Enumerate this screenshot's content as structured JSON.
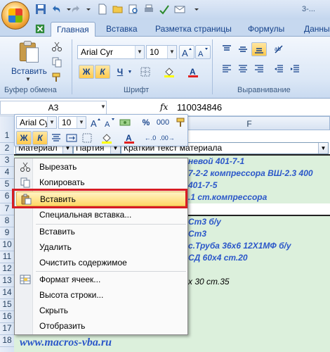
{
  "title_bar": {
    "doc_title": "3-..."
  },
  "tabs": [
    "Главная",
    "Вставка",
    "Разметка страницы",
    "Формулы",
    "Данны"
  ],
  "ribbon": {
    "clipboard": {
      "paste_label": "Вставить",
      "group_label": "Буфер обмена"
    },
    "font": {
      "font_name": "Arial Cyr",
      "font_size": "10",
      "bold": "Ж",
      "italic": "К",
      "underline": "Ч",
      "group_label": "Шрифт"
    },
    "alignment": {
      "group_label": "Выравнивание"
    }
  },
  "formula_bar": {
    "name_box": "A3",
    "fx": "fx",
    "formula": "110034846"
  },
  "sheet": {
    "column_f": "F",
    "rows": [
      "1",
      "2",
      "3",
      "4",
      "5",
      "6",
      "7",
      "8",
      "9",
      "10",
      "11",
      "12",
      "13",
      "14",
      "15",
      "16",
      "17",
      "18"
    ],
    "headers": {
      "material": "Материал",
      "batch": "Партия",
      "short_text": "Краткий текст материала"
    },
    "cells": {
      "r3": "невой 401-7-1",
      "r4": "7-2-2 компрессора ВШ-2.3 400",
      "r5": "401-7-5",
      "r6": ".1 ст.компрессора",
      "r8": "Ст3 б/у",
      "r9": "Ст3",
      "r10": "с.Труба 36х6 12Х1МФ б/у",
      "r11": "СД 60х4 ст.20",
      "r13": "х 30 ст.35"
    }
  },
  "mini_toolbar": {
    "font_name": "Arial Cyr",
    "font_size": "10",
    "percent": "%",
    "thousands": "000"
  },
  "context_menu": {
    "items": [
      {
        "label": "Вырезать",
        "icon": "scissors-icon"
      },
      {
        "label": "Копировать",
        "icon": "copy-icon"
      },
      {
        "label": "Вставить",
        "icon": "paste-icon"
      },
      {
        "label": "Специальная вставка...",
        "icon": ""
      },
      {
        "label": "Вставить",
        "icon": ""
      },
      {
        "label": "Удалить",
        "icon": ""
      },
      {
        "label": "Очистить содержимое",
        "icon": ""
      },
      {
        "label": "Формат ячеек...",
        "icon": "format-cells-icon"
      },
      {
        "label": "Высота строки...",
        "icon": ""
      },
      {
        "label": "Скрыть",
        "icon": ""
      },
      {
        "label": "Отобразить",
        "icon": ""
      }
    ]
  },
  "watermark": "www.macros-vba.ru"
}
